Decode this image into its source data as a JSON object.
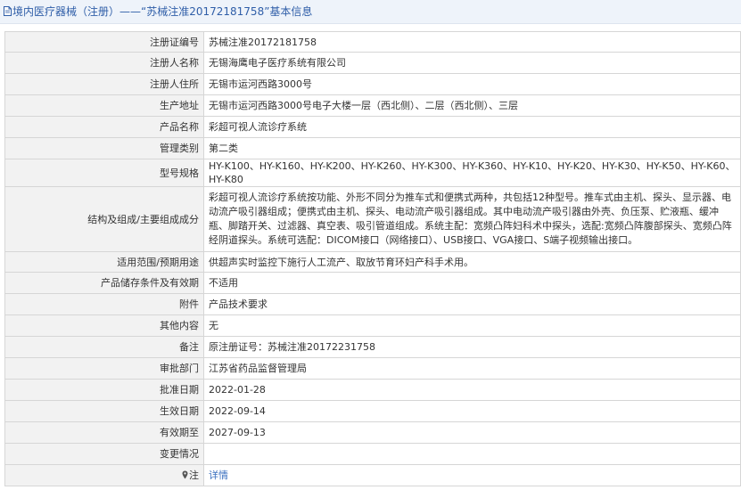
{
  "header": {
    "title": "境内医疗器械（注册）——“苏械注准20172181758”基本信息"
  },
  "rows": [
    {
      "label": "注册证编号",
      "value": "苏械注准20172181758"
    },
    {
      "label": "注册人名称",
      "value": "无锡海鹰电子医疗系统有限公司"
    },
    {
      "label": "注册人住所",
      "value": "无锡市运河西路3000号"
    },
    {
      "label": "生产地址",
      "value": "无锡市运河西路3000号电子大楼一层（西北侧）、二层（西北侧）、三层"
    },
    {
      "label": "产品名称",
      "value": "彩超可视人流诊疗系统"
    },
    {
      "label": "管理类别",
      "value": "第二类"
    },
    {
      "label": "型号规格",
      "value": "HY-K100、HY-K160、HY-K200、HY-K260、HY-K300、HY-K360、HY-K10、HY-K20、HY-K30、HY-K50、HY-K60、HY-K80"
    },
    {
      "label": "结构及组成/主要组成成分",
      "value": "彩超可视人流诊疗系统按功能、外形不同分为推车式和便携式两种，共包括12种型号。推车式由主机、探头、显示器、电动流产吸引器组成；便携式由主机、探头、电动流产吸引器组成。其中电动流产吸引器由外壳、负压泵、贮液瓶、缓冲瓶、脚踏开关、过滤器、真空表、吸引管道组成。系统主配：宽频凸阵妇科术中探头，选配:宽频凸阵腹部探头、宽频凸阵经阴道探头。系统可选配：DICOM接口（网络接口）、USB接口、VGA接口、S端子视频输出接口。"
    },
    {
      "label": "适用范围/预期用途",
      "value": "供超声实时监控下施行人工流产、取放节育环妇产科手术用。"
    },
    {
      "label": "产品储存条件及有效期",
      "value": "不适用"
    },
    {
      "label": "附件",
      "value": "产品技术要求"
    },
    {
      "label": "其他内容",
      "value": "无"
    },
    {
      "label": "备注",
      "value": "原注册证号：苏械注准20172231758"
    },
    {
      "label": "审批部门",
      "value": "江苏省药品监督管理局"
    },
    {
      "label": "批准日期",
      "value": "2022-01-28"
    },
    {
      "label": "生效日期",
      "value": "2022-09-14"
    },
    {
      "label": "有效期至",
      "value": "2027-09-13"
    },
    {
      "label": "变更情况",
      "value": ""
    }
  ],
  "note_row": {
    "label": "注",
    "link": "详情"
  },
  "colors": {
    "title": "#2f5ea8",
    "link": "#3a6fbf",
    "label_bg": "#f2f2f2",
    "border": "#d6d6d6"
  }
}
